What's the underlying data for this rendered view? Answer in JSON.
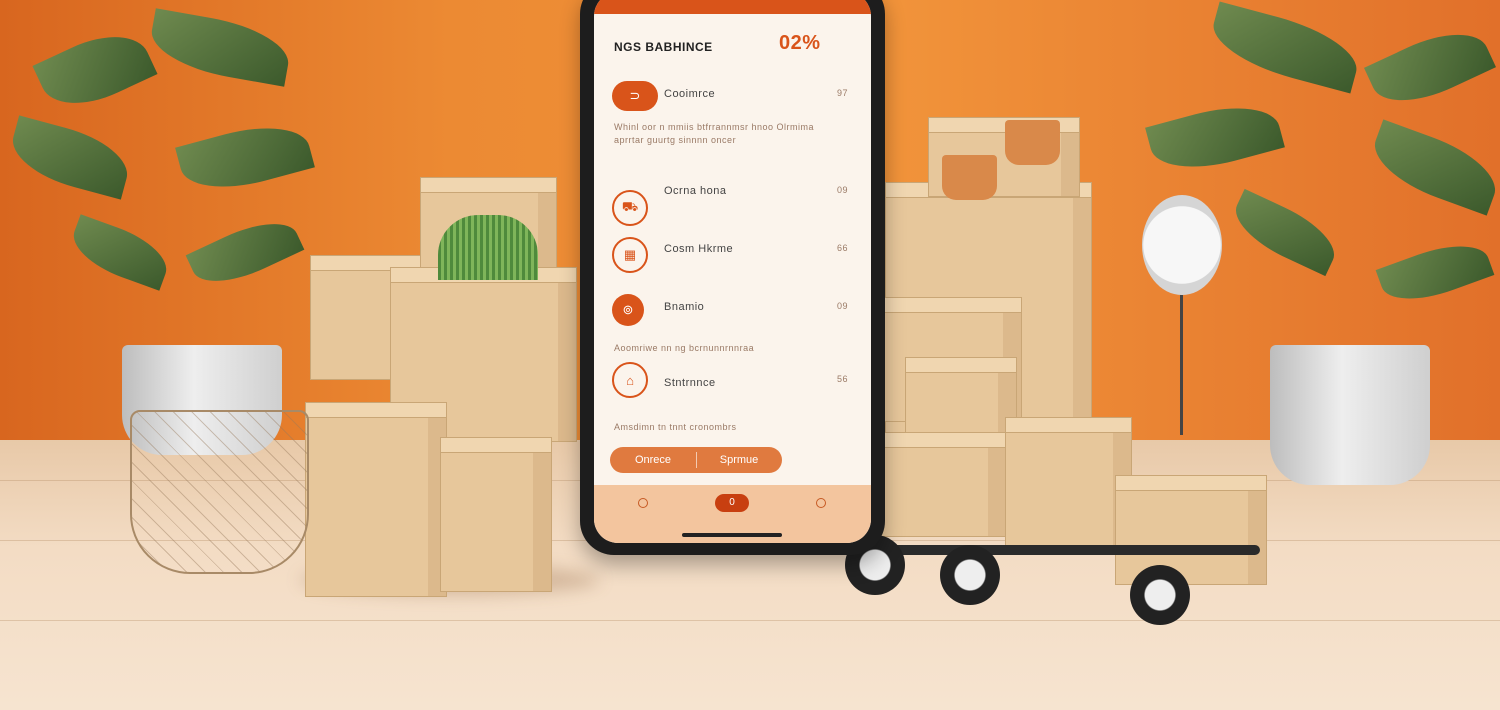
{
  "app": {
    "title": "NGS BABHINCE",
    "percent": "02%"
  },
  "list": [
    {
      "icon": "toggle-icon",
      "label": "Cooimrce",
      "value": "97",
      "iconChar": "⊃"
    },
    {
      "icon": "truck-icon",
      "label": "Ocrna hona",
      "value": "09",
      "iconChar": "⛟"
    },
    {
      "icon": "calendar-icon",
      "label": "Cosm Hkrme",
      "value": "66",
      "iconChar": "▦"
    },
    {
      "icon": "lock-icon",
      "label": "Bnamio",
      "value": "09",
      "iconChar": "🔒"
    },
    {
      "icon": "box-icon",
      "label": "Stntrnnce",
      "value": "56",
      "iconChar": "⌂"
    }
  ],
  "paragraph1": "Whinl oor n mmiis btfrrannmsr hnoo Olrmima",
  "paragraph2": "aprrtar guurtg sinnnn oncer",
  "section_note": "Aoomriwe nn ng bcrnunnrnnraa",
  "footer_note": "Amsdimn tn tnnt cronombrs",
  "buttons": {
    "primary": "Onrece",
    "secondary": "Sprmue"
  },
  "nav": {
    "active": "0"
  },
  "colors": {
    "accent": "#d9541a",
    "wall": "#ec8a33",
    "floor": "#f3dcc4",
    "box": "#e7c79b"
  }
}
